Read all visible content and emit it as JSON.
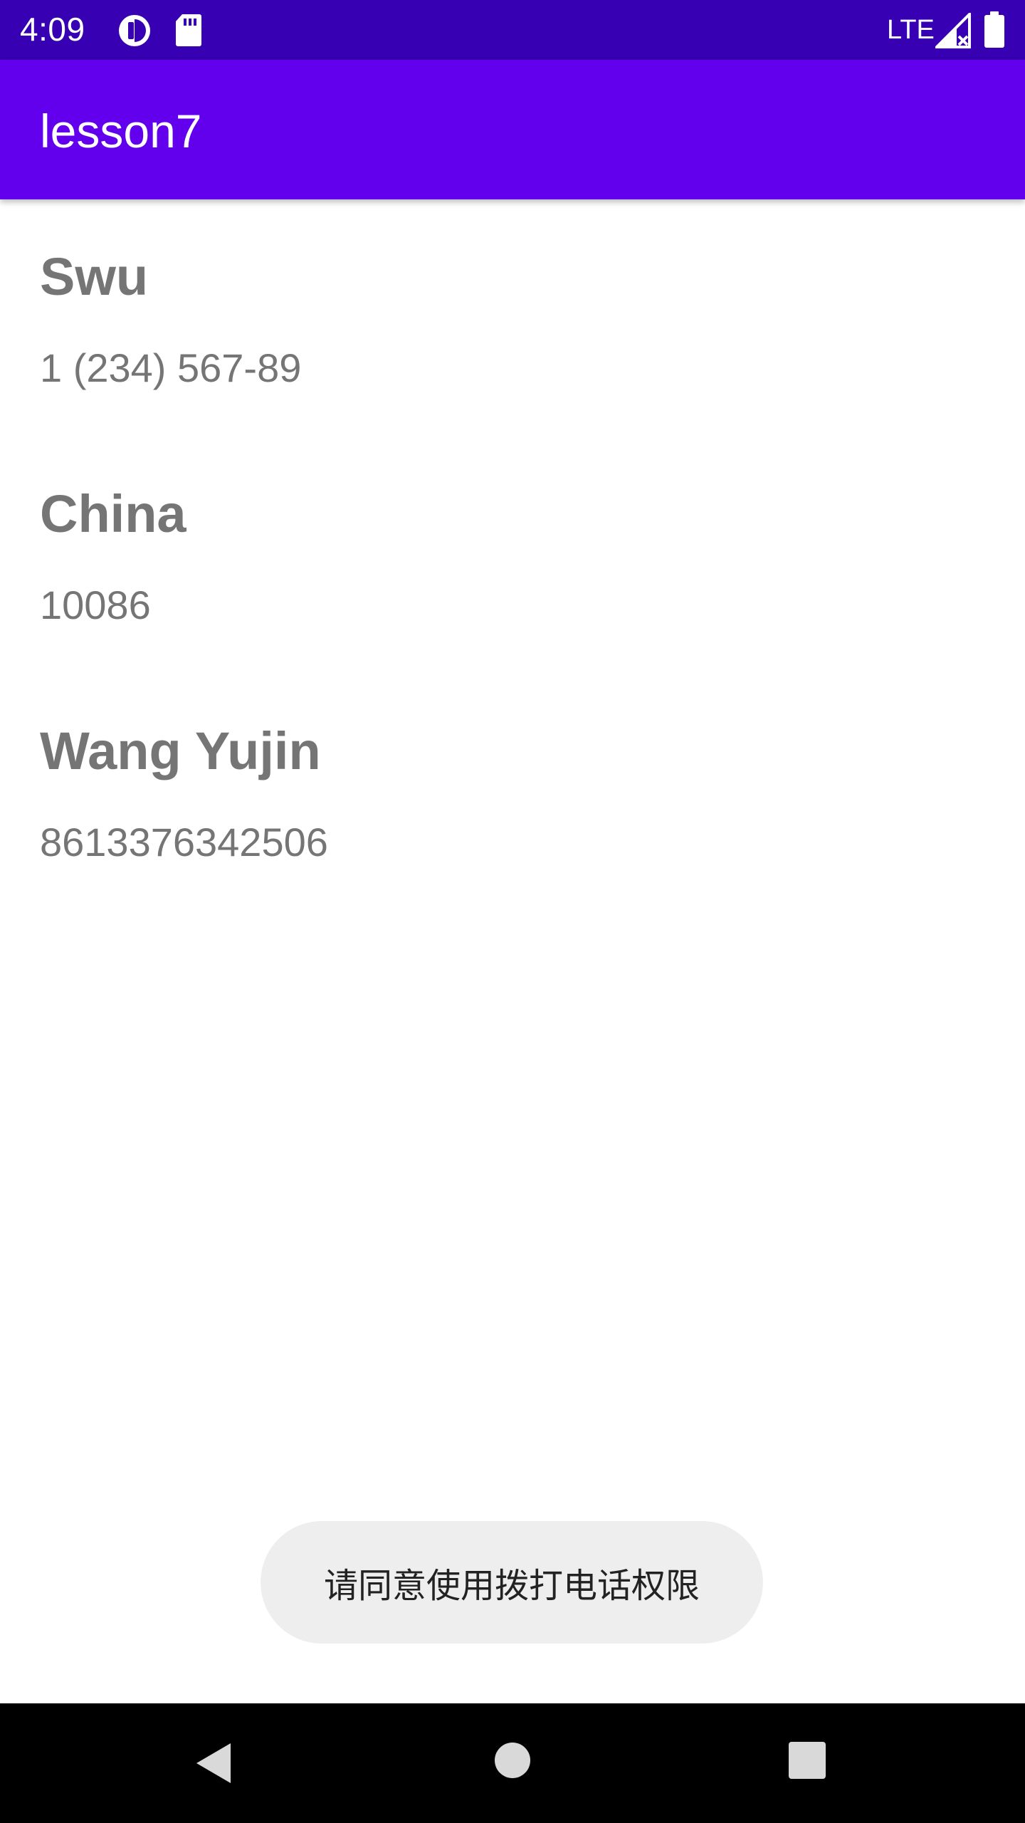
{
  "status_bar": {
    "time": "4:09",
    "network_label": "LTE",
    "icons": [
      "data-saver-icon",
      "sd-card-icon",
      "signal-no-data-icon",
      "battery-icon"
    ]
  },
  "app_bar": {
    "title": "lesson7"
  },
  "contacts": [
    {
      "name": "Swu",
      "phone": "1 (234) 567-89"
    },
    {
      "name": "China",
      "phone": "10086"
    },
    {
      "name": "Wang Yujin",
      "phone": "8613376342506"
    }
  ],
  "toast": {
    "message": "请同意使用拨打电话权限"
  },
  "nav_bar": {
    "buttons": [
      "back-icon",
      "home-icon",
      "recents-icon"
    ]
  },
  "colors": {
    "status_bar": "#3700b3",
    "app_bar": "#6200ee",
    "text_secondary": "#757575",
    "toast_bg": "#eeeeee",
    "nav_bar": "#000000"
  }
}
